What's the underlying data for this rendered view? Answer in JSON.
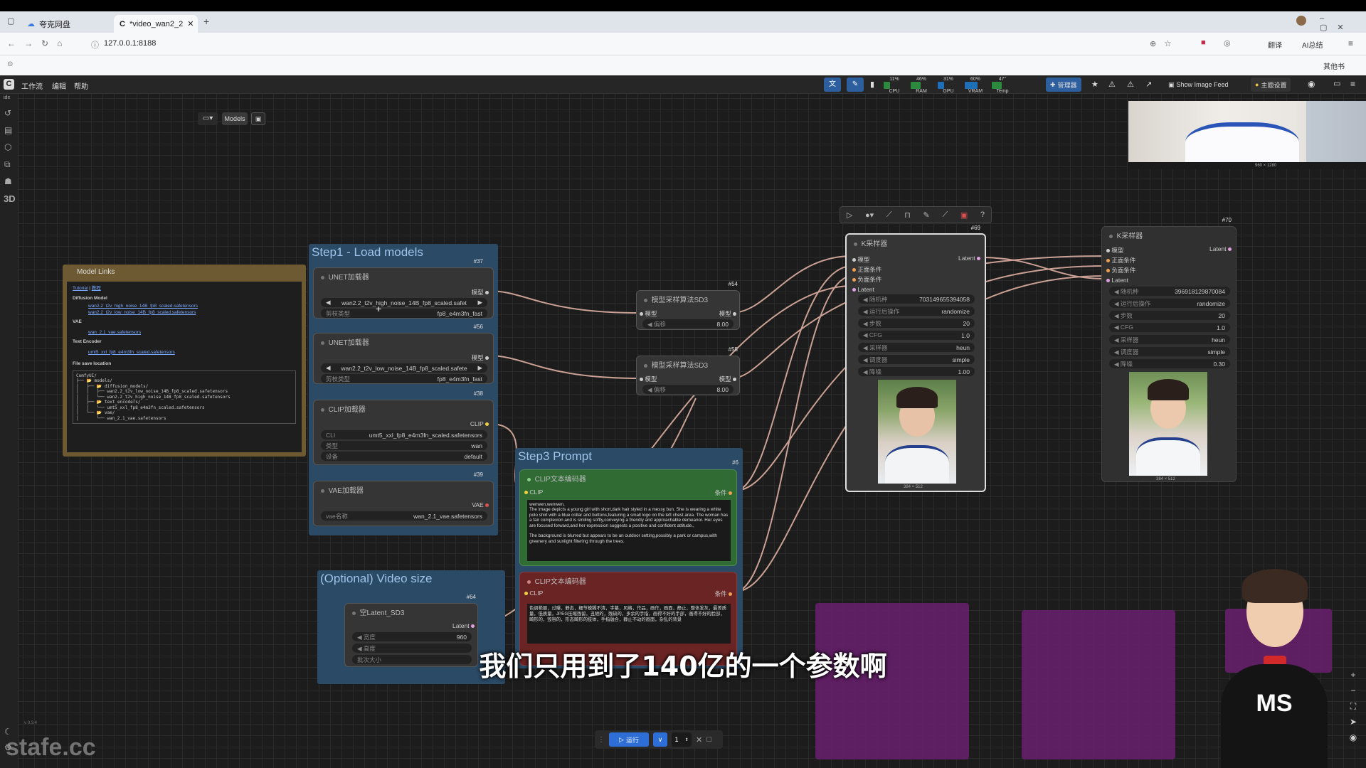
{
  "browser": {
    "tabs": [
      {
        "label": "夸克网盘"
      },
      {
        "label": "*video_wan2_2"
      }
    ],
    "url": "127.0.0.1:8188",
    "bookmark_other": "其他书",
    "ai_label": "AI总结",
    "translate_label": "翻译"
  },
  "menu": {
    "items": [
      "工作流",
      "编辑",
      "帮助"
    ],
    "meters": [
      {
        "label": "CPU",
        "value": "11%"
      },
      {
        "label": "RAM",
        "value": "46%"
      },
      {
        "label": "GPU",
        "value": "31%"
      },
      {
        "label": "VRAM",
        "value": "60%"
      },
      {
        "label": "Temp",
        "value": "47°"
      }
    ],
    "manager": "管理器",
    "image_feed": "Show Image Feed",
    "theme": "主题设置"
  },
  "canvas_toolbar": {
    "models_label": "Models"
  },
  "subtitle": "我们只用到了140亿的一个参数啊",
  "watermark": "stafe.cc",
  "avatar_shirt": "MS",
  "version": "v 0.3.4",
  "preview_top": {
    "dims": "960 × 1280"
  },
  "model_links": {
    "title": "Model Links",
    "tutorial": "Tutorial",
    "tutorial2": "教程",
    "diffusion_heading": "Diffusion Model",
    "diffusion_links": [
      "wan2.2_t2v_high_noise_14B_fp8_scaled.safetensors",
      "wan2.2_t2v_low_noise_14B_fp8_scaled.safetensors"
    ],
    "vae_heading": "VAE",
    "vae_links": [
      "wan_2.1_vae.safetensors"
    ],
    "text_heading": "Text Encoder",
    "text_links": [
      "umt5_xxl_fp8_e4m3fn_scaled.safetensors"
    ],
    "save_heading": "File save location",
    "tree": [
      "ComfyUI/",
      "├── 📂 models/",
      "│   ├── 📂 diffusion_models/",
      "│   │   ├── wan2.2_t2v_low_noise_14B_fp8_scaled.safetensors",
      "│   │   └── wan2.2_t2v_high_noise_14B_fp8_scaled.safetensors",
      "│   ├── 📂 text_encoders/",
      "│   │   └── umt5_xxl_fp8_e4m3fn_scaled.safetensors",
      "│   └── 📂 vae/",
      "│       └── wan_2.1_vae.safetensors"
    ]
  },
  "step1": {
    "title": "Step1 - Load models",
    "unet1": {
      "title": "UNET加载器",
      "badge": "#37",
      "out": "模型",
      "model": "wan2.2_t2v_high_noise_14B_fp8_scaled.safet",
      "wtype_label": "剪枝类型",
      "wtype": "fp8_e4m3fn_fast"
    },
    "unet2": {
      "title": "UNET加载器",
      "badge": "#56",
      "out": "模型",
      "model": "wan2.2_t2v_low_noise_14B_fp8_scaled.safete",
      "wtype_label": "剪枝类型",
      "wtype": "fp8_e4m3fn_fast"
    },
    "clip": {
      "title": "CLIP加载器",
      "badge": "#38",
      "out": "CLIP",
      "name_label": "CLI",
      "name": "umt5_xxl_fp8_e4m3fn_scaled.safetensors",
      "type_label": "类型",
      "type": "wan",
      "device_label": "设备",
      "device": "default"
    },
    "vae": {
      "title": "VAE加载器",
      "badge": "#39",
      "out": "VAE",
      "name_label": "vae名称",
      "name": "wan_2.1_vae.safetensors"
    }
  },
  "sd3a": {
    "title": "模型采样算法SD3",
    "badge": "#54",
    "in": "模型",
    "out": "模型",
    "shift_label": "偏移",
    "shift": "8.00"
  },
  "sd3b": {
    "title": "模型采样算法SD3",
    "badge": "#55",
    "in": "模型",
    "out": "模型",
    "shift_label": "偏移",
    "shift": "8.00"
  },
  "step3": {
    "title": "Step3 Prompt",
    "badge": "#6",
    "pos": {
      "title": "CLIP文本编码器",
      "in": "CLIP",
      "out": "条件",
      "text": "wenwen,wenwen,\nThe image depicts a young girl with short,dark hair styled in a messy bun. She is wearing a white polo shirt with a blue collar and buttons,featuring a small logo on the left chest area. The woman has a fair complexion and is smiling softly,conveying a friendly and approachable demeanor. Her eyes are focused forward,and her expression suggests a positive and confident attitude.,\n\nThe background is blurred but appears to be an outdoor setting,possibly a park or campus,with greenery and sunlight filtering through the trees."
    },
    "neg": {
      "title": "CLIP文本编码器",
      "in": "CLIP",
      "out": "条件",
      "text": "色调艳丽，过曝，静态，细节模糊不清，字幕，风格，作品，画作，画面，静止，整体发灰，最差质量，低质量，JPEG压缩残留，丑陋的，残缺的，多余的手指，画得不好的手部，画得不好的脸部，畸形的，毁容的，形态畸形的肢体，手指融合，静止不动的画面，杂乱的背景"
    }
  },
  "videosize": {
    "title": "(Optional) Video size",
    "badge": "#64",
    "node": "空Latent_SD3",
    "out": "Latent",
    "w_label": "宽度",
    "w": "960",
    "h_label": "高度",
    "b_label": "批次大小"
  },
  "ksampler1": {
    "title": "K采样器",
    "badge": "#69",
    "inputs": [
      "模型",
      "正面条件",
      "负面条件",
      "Latent"
    ],
    "out": "Latent",
    "widgets": [
      {
        "label": "随机种",
        "value": "703149655394058"
      },
      {
        "label": "运行后操作",
        "value": "randomize"
      },
      {
        "label": "步数",
        "value": "20"
      },
      {
        "label": "CFG",
        "value": "1.0"
      },
      {
        "label": "采样器",
        "value": "heun"
      },
      {
        "label": "调度器",
        "value": "simple"
      },
      {
        "label": "降噪",
        "value": "1.00"
      }
    ],
    "dims": "384 × 512"
  },
  "ksampler2": {
    "title": "K采样器",
    "badge": "#70",
    "inputs": [
      "模型",
      "正面条件",
      "负面条件",
      "Latent"
    ],
    "out": "Latent",
    "widgets": [
      {
        "label": "随机种",
        "value": "396918129870084"
      },
      {
        "label": "运行后操作",
        "value": "randomize"
      },
      {
        "label": "步数",
        "value": "20"
      },
      {
        "label": "CFG",
        "value": "1.0"
      },
      {
        "label": "采样器",
        "value": "heun"
      },
      {
        "label": "调度器",
        "value": "simple"
      },
      {
        "label": "降噪",
        "value": "0.30"
      }
    ],
    "dims": "384 × 512"
  },
  "run": {
    "label": "运行",
    "count": "1"
  },
  "colors": {
    "accent": "#2d5e9e",
    "group_blue": "#2b4a66",
    "group_brown": "#6e5a32",
    "positive": "#2f6b33",
    "negative": "#6b2424",
    "purple_node": "#6a1e6e",
    "link": "#e8b8a8"
  }
}
